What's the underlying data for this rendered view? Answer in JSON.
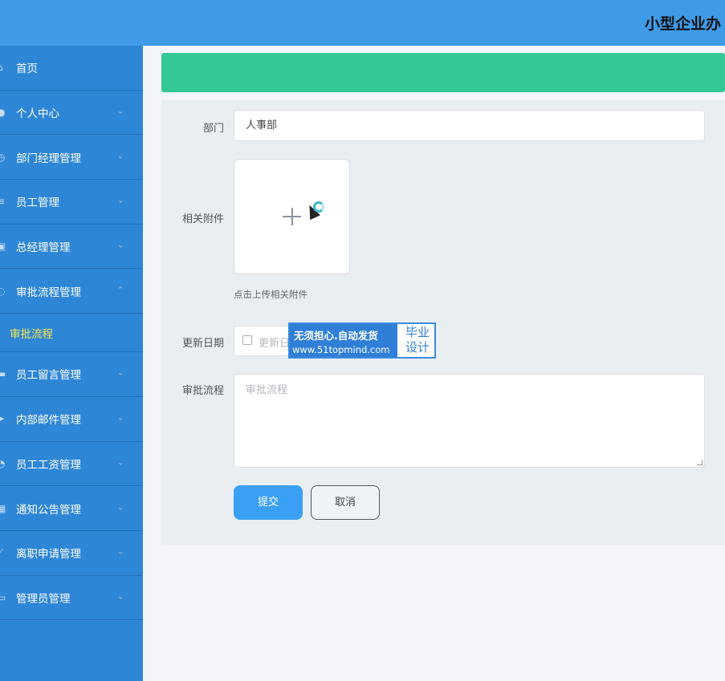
{
  "header": {
    "title": "小型企业办"
  },
  "sidebar": {
    "items": [
      {
        "label": "首页",
        "icon": "home-icon",
        "chevron": ""
      },
      {
        "label": "个人中心",
        "icon": "user-icon",
        "chevron": "⌄"
      },
      {
        "label": "部门经理管理",
        "icon": "clock-icon",
        "chevron": "⌄"
      },
      {
        "label": "员工管理",
        "icon": "list-icon",
        "chevron": "⌄"
      },
      {
        "label": "总经理管理",
        "icon": "badge-icon",
        "chevron": "⌄"
      },
      {
        "label": "审批流程管理",
        "icon": "flow-icon",
        "chevron": "⌃"
      },
      {
        "label": "审批流程",
        "icon": "",
        "chevron": ""
      },
      {
        "label": "员工留言管理",
        "icon": "monitor-icon",
        "chevron": "⌄"
      },
      {
        "label": "内部邮件管理",
        "icon": "send-icon",
        "chevron": "⌄"
      },
      {
        "label": "员工工资管理",
        "icon": "power-icon",
        "chevron": "⌄"
      },
      {
        "label": "通知公告管理",
        "icon": "grid-icon",
        "chevron": "⌄"
      },
      {
        "label": "离职申请管理",
        "icon": "chart-icon",
        "chevron": "⌄"
      },
      {
        "label": "管理员管理",
        "icon": "card-icon",
        "chevron": "⌄"
      }
    ]
  },
  "form": {
    "department_label": "部门",
    "department_value": "人事部",
    "attachment_label": "相关附件",
    "attachment_hint": "点击上传相关附件",
    "date_label": "更新日期",
    "date_placeholder": "更新日",
    "flow_label": "审批流程",
    "flow_placeholder": "审批流程",
    "submit_label": "提交",
    "cancel_label": "取消"
  },
  "watermark": {
    "line1": "无须担心.自动发货",
    "line2": "www.51topmind.com",
    "right_line1": "毕业",
    "right_line2": "设计"
  }
}
